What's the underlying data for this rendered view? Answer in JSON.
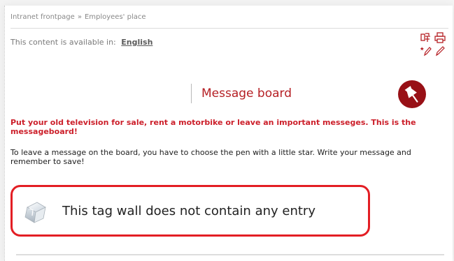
{
  "breadcrumb": {
    "items": [
      "Intranet frontpage",
      "Employees' place"
    ],
    "separator": "»"
  },
  "language": {
    "label": "This content is available in:",
    "link": "English"
  },
  "toolbar": {
    "icons": [
      "translate-icon",
      "print-icon",
      "add-entry-pen-icon",
      "edit-pen-icon"
    ]
  },
  "board": {
    "title": "Message board",
    "icon": "pushpin-icon",
    "intro_red": "Put your old television for sale, rent a motorbike or leave an important messeges. This is the messageboard!",
    "intro_black": "To leave a message on the board, you have to choose the pen with a little star. Write your message and remember to save!"
  },
  "empty_state": {
    "icon": "ice-cube-icon",
    "text": "This tag wall does not contain any entry"
  },
  "colors": {
    "accent_red": "#cc1f2a",
    "highlight_border": "#e31e24",
    "badge": "#981016",
    "title_red": "#b51f24"
  }
}
